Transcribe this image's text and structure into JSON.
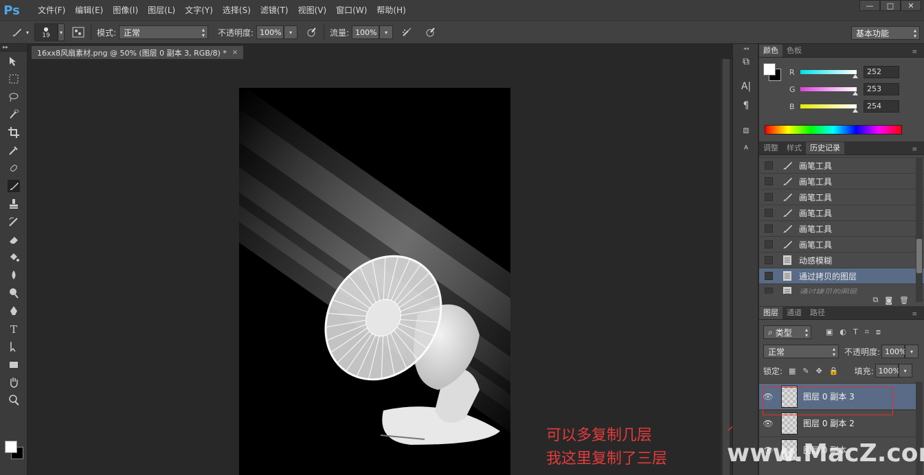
{
  "app": {
    "logo": "Ps"
  },
  "menu": [
    "文件(F)",
    "编辑(E)",
    "图像(I)",
    "图层(L)",
    "文字(Y)",
    "选择(S)",
    "滤镜(T)",
    "视图(V)",
    "窗口(W)",
    "帮助(H)"
  ],
  "window_controls": {
    "minimize": "—",
    "maximize": "□",
    "close": "✕"
  },
  "options": {
    "brush_size": "19",
    "mode_label": "模式:",
    "mode_value": "正常",
    "opacity_label": "不透明度:",
    "opacity_value": "100%",
    "flow_label": "流量:",
    "flow_value": "100%",
    "workspace": "基本功能"
  },
  "document": {
    "tab_title": "16xx8风扇素材.png @ 50% (图层 0 副本 3, RGB/8) *",
    "close": "×"
  },
  "color_panel": {
    "tabs": [
      "颜色",
      "色板"
    ],
    "active_tab": 0,
    "channels": [
      {
        "label": "R",
        "value": "252",
        "color": "#00e0e8"
      },
      {
        "label": "G",
        "value": "253",
        "color": "#e040e0"
      },
      {
        "label": "B",
        "value": "254",
        "color": "#e8e800"
      }
    ]
  },
  "history_panel": {
    "tabs": [
      "调整",
      "样式",
      "历史记录"
    ],
    "active_tab": 2,
    "items": [
      {
        "label": "画笔工具",
        "icon": "brush-icon",
        "state": "normal"
      },
      {
        "label": "画笔工具",
        "icon": "brush-icon",
        "state": "normal"
      },
      {
        "label": "画笔工具",
        "icon": "brush-icon",
        "state": "normal"
      },
      {
        "label": "画笔工具",
        "icon": "brush-icon",
        "state": "normal"
      },
      {
        "label": "画笔工具",
        "icon": "brush-icon",
        "state": "normal"
      },
      {
        "label": "画笔工具",
        "icon": "brush-icon",
        "state": "normal"
      },
      {
        "label": "动感模糊",
        "icon": "document-icon",
        "state": "normal"
      },
      {
        "label": "通过拷贝的图层",
        "icon": "document-icon",
        "state": "selected"
      },
      {
        "label": "通过拷贝的图层",
        "icon": "document-icon",
        "state": "dimmed"
      }
    ]
  },
  "layers_panel": {
    "tabs": [
      "图层",
      "通道",
      "路径"
    ],
    "active_tab": 0,
    "filter_label": "类型",
    "blend_mode": "正常",
    "opacity_label": "不透明度:",
    "opacity_value": "100%",
    "lock_label": "锁定:",
    "fill_label": "填充:",
    "fill_value": "100%",
    "layers": [
      {
        "name": "图层 0 副本 3",
        "selected": true
      },
      {
        "name": "图层 0 副本 2",
        "selected": false
      },
      {
        "name": "图层 0 副本",
        "selected": false
      }
    ]
  },
  "annotation": {
    "line1": "可以多复制几层",
    "line2": "我这里复制了三层"
  },
  "watermark": "www.MacZ.com",
  "toolbar_tools": [
    "move-tool-icon",
    "marquee-tool-icon",
    "lasso-tool-icon",
    "quick-select-tool-icon",
    "crop-tool-icon",
    "eyedropper-tool-icon",
    "healing-brush-icon",
    "brush-tool-icon",
    "clone-stamp-icon",
    "history-brush-icon",
    "eraser-tool-icon",
    "paint-bucket-icon",
    "blur-tool-icon",
    "dodge-tool-icon",
    "pen-tool-icon",
    "type-tool-icon",
    "path-select-icon",
    "shape-tool-icon",
    "hand-tool-icon",
    "zoom-tool-icon"
  ]
}
